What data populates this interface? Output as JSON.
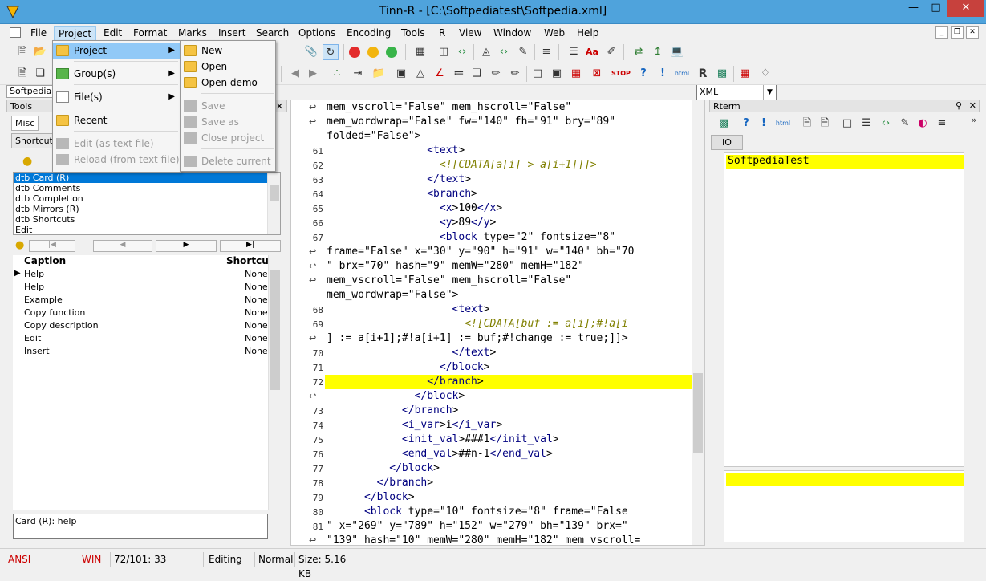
{
  "window": {
    "title": "Tinn-R - [C:\\Softpediatest\\Softpedia.xml]"
  },
  "menubar": [
    "File",
    "Project",
    "Edit",
    "Format",
    "Marks",
    "Insert",
    "Search",
    "Options",
    "Encoding",
    "Tools",
    "R",
    "View",
    "Window",
    "Web",
    "Help"
  ],
  "project_menu": {
    "items": [
      {
        "label": "Project",
        "has_sub": true,
        "state": "highlighted"
      },
      {
        "label": "Group(s)",
        "has_sub": true
      },
      {
        "label": "File(s)",
        "has_sub": true
      },
      {
        "label": "Recent"
      },
      {
        "label": "Edit (as text file)",
        "disabled": true
      },
      {
        "label": "Reload (from text file)",
        "disabled": true
      }
    ]
  },
  "project_submenu": {
    "items": [
      {
        "label": "New"
      },
      {
        "label": "Open"
      },
      {
        "label": "Open demo"
      },
      {
        "label": "Save",
        "disabled": true
      },
      {
        "label": "Save as",
        "disabled": true
      },
      {
        "label": "Close project",
        "disabled": true
      },
      {
        "label": "Delete current",
        "disabled": true
      }
    ]
  },
  "toolbar": {
    "syntax_select": "XML"
  },
  "left_panel": {
    "file_tab": "Softpedia.x",
    "title": "Tools",
    "tabs": [
      "Misc",
      "Shortcuts"
    ],
    "groups": [
      "dtb Card (R)",
      "dtb Comments",
      "dtb Completion",
      "dtb Mirrors (R)",
      "dtb Shortcuts",
      "Edit"
    ],
    "grid_headers": {
      "caption": "Caption",
      "shortcut": "Shortcut"
    },
    "grid_rows": [
      {
        "caption": "Help",
        "shortcut": "None"
      },
      {
        "caption": "Help",
        "shortcut": "None"
      },
      {
        "caption": "Example",
        "shortcut": "None"
      },
      {
        "caption": "Copy function",
        "shortcut": "None"
      },
      {
        "caption": "Copy description",
        "shortcut": "None"
      },
      {
        "caption": "Edit",
        "shortcut": "None"
      },
      {
        "caption": "Insert",
        "shortcut": "None"
      }
    ],
    "description": "Card (R): help"
  },
  "editor": {
    "lines": [
      {
        "n": "",
        "wrap": true,
        "text": "mem_vscroll=\"False\" mem_hscroll=\"False\""
      },
      {
        "n": "",
        "wrap": true,
        "text": "mem_wordwrap=\"False\" fw=\"140\" fh=\"91\" bry=\"89\""
      },
      {
        "n": "",
        "wrap": false,
        "text": "folded=\"False\">"
      },
      {
        "n": "61",
        "text": "                <text>"
      },
      {
        "n": "62",
        "text": "                  <![CDATA[a[i] > a[i+1]]]>"
      },
      {
        "n": "63",
        "text": "                </text>"
      },
      {
        "n": "64",
        "text": "                <branch>"
      },
      {
        "n": "65",
        "text": "                  <x>100</x>"
      },
      {
        "n": "66",
        "text": "                  <y>89</y>"
      },
      {
        "n": "67",
        "text": "                  <block type=\"2\" fontsize=\"8\""
      },
      {
        "n": "",
        "wrap": true,
        "text": "frame=\"False\" x=\"30\" y=\"90\" h=\"91\" w=\"140\" bh=\"70"
      },
      {
        "n": "",
        "wrap": true,
        "text": "\" brx=\"70\" hash=\"9\" memW=\"280\" memH=\"182\""
      },
      {
        "n": "",
        "wrap": true,
        "text": "mem_vscroll=\"False\" mem_hscroll=\"False\""
      },
      {
        "n": "",
        "wrap": false,
        "text": "mem_wordwrap=\"False\">"
      },
      {
        "n": "68",
        "text": "                    <text>"
      },
      {
        "n": "69",
        "text": "                      <![CDATA[buf := a[i];#!a[i"
      },
      {
        "n": "",
        "wrap": true,
        "text": "] := a[i+1];#!a[i+1] := buf;#!change := true;]]>"
      },
      {
        "n": "70",
        "text": "                    </text>"
      },
      {
        "n": "71",
        "text": "                  </block>"
      },
      {
        "n": "72",
        "text": "                </branch>",
        "highlight": true
      },
      {
        "n": "",
        "text": "              </block>"
      },
      {
        "n": "73",
        "text": "            </branch>"
      },
      {
        "n": "74",
        "text": "            <i_var>i</i_var>"
      },
      {
        "n": "75",
        "text": "            <init_val>###1</init_val>"
      },
      {
        "n": "76",
        "text": "            <end_val>##n-1</end_val>"
      },
      {
        "n": "77",
        "text": "          </block>"
      },
      {
        "n": "78",
        "text": "        </branch>"
      },
      {
        "n": "79",
        "text": "      </block>"
      },
      {
        "n": "80",
        "text": "      <block type=\"10\" fontsize=\"8\" frame=\"False"
      },
      {
        "n": "81",
        "text": "\" x=\"269\" y=\"789\" h=\"152\" w=\"279\" bh=\"139\" brx=\""
      },
      {
        "n": "",
        "wrap": true,
        "text": "\"139\" hash=\"10\" memW=\"280\" memH=\"182\" mem_vscroll="
      }
    ]
  },
  "rterm": {
    "title": "Rterm",
    "tab": "IO",
    "output": "SoftpediaTest"
  },
  "statusbar": {
    "encoding": "ANSI",
    "eol": "WIN",
    "position": "72/101: 33",
    "mode": "Editing",
    "view": "Normal",
    "size": "Size: 5.16 KB"
  }
}
